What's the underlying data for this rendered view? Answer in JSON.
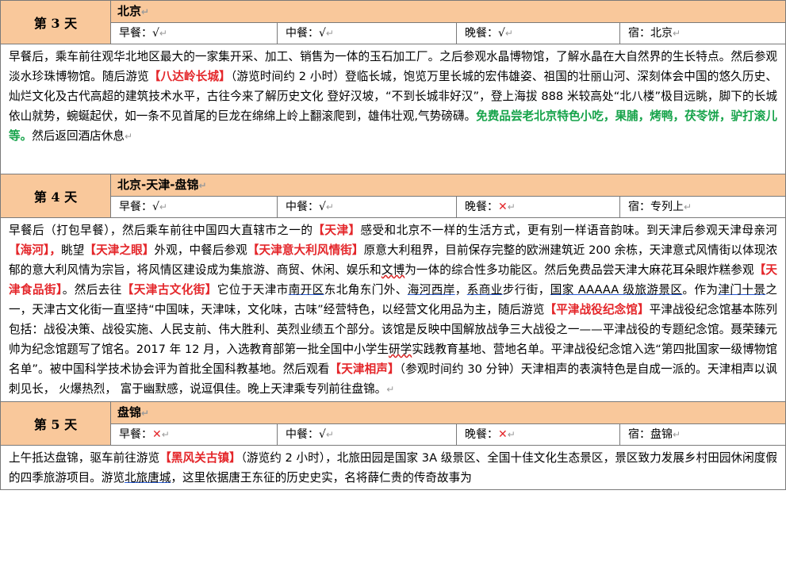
{
  "paragraph_mark": "↵",
  "days": [
    {
      "label": "第 3 天",
      "route": "北京",
      "breakfast": {
        "label": "早餐：",
        "mark": "√"
      },
      "lunch": {
        "label": "中餐：",
        "mark": "√"
      },
      "dinner": {
        "label": "晚餐：",
        "mark": "√"
      },
      "lodging": {
        "label": "宿：",
        "value": "北京"
      },
      "segments": [
        {
          "text": "早餐后，乘车前往观华北地区最大的一家集开采、加工、销售为一体的玉石加工厂。之后参观水晶博物馆，了解水晶在大自然界的生长特点。然后参观淡水珍珠博物馆。随后游览"
        },
        {
          "text": "【八达岭长城】",
          "style": "red"
        },
        {
          "text": "（游览时间约 2 小时）登临长城，饱览万里长城的宏伟雄姿、祖国的壮丽山河、深刻体会中国的悠久历史、灿烂文化及古代高超的建筑技术水平，古往今来了解历史文化 登好汉坡，“不到长城非好汉”，登上海拔 888 米较高处“北八楼”极目远眺，脚下的长城依山就势，蜿蜒起伏，如一条不见首尾的巨龙在绵绵上岭上翻滚爬到，雄伟壮观,气势磅礴。"
        },
        {
          "text": "免费品尝老北京特色小吃，果脯，烤鸭，茯苓饼，驴打滚儿等。",
          "style": "green"
        },
        {
          "text": "然后返回酒店休息"
        }
      ]
    },
    {
      "label": "第 4 天",
      "route": "北京-天津-盘锦",
      "breakfast": {
        "label": "早餐：",
        "mark": "√"
      },
      "lunch": {
        "label": "中餐：",
        "mark": "√"
      },
      "dinner": {
        "label": "晚餐：",
        "mark": "✕"
      },
      "lodging": {
        "label": "宿：",
        "value": "专列上"
      },
      "segments": [
        {
          "text": "早餐后（打包早餐），然后乘车前往中国四大直辖市之一的"
        },
        {
          "text": "【天津】",
          "style": "red"
        },
        {
          "text": "感受和北京不一样的生活方式，更有别一样语音韵味。到天津后参观天津母亲河"
        },
        {
          "text": "【海河】，",
          "style": "red"
        },
        {
          "text": "眺望"
        },
        {
          "text": "【天津之眼】",
          "style": "red"
        },
        {
          "text": "外观，中餐后参观"
        },
        {
          "text": "【天津意大利风情街】",
          "style": "red"
        },
        {
          "text": "原意大利租界，目前保存完整的欧洲建筑近 200 余栋，天津意式风情街以体现浓郁的意大利风情为宗旨，将风情区建设成为集旅游、商贸、休闲、娱乐和"
        },
        {
          "text": "文博",
          "style": "wavy"
        },
        {
          "text": "为一体的综合性多功能区。然后免费品尝天津大麻花耳朵眼炸糕参观"
        },
        {
          "text": "【天津食品街】",
          "style": "red"
        },
        {
          "text": "。然后去往"
        },
        {
          "text": "【天津古文化街】",
          "style": "red"
        },
        {
          "text": "它位于天津市"
        },
        {
          "text": "南开区",
          "style": "ul"
        },
        {
          "text": "东北角东门外、"
        },
        {
          "text": "海河西岸",
          "style": "ul"
        },
        {
          "text": "，"
        },
        {
          "text": "系商业",
          "style": "ul"
        },
        {
          "text": "步行街，"
        },
        {
          "text": "国家 AAAAA 级旅游景区",
          "style": "ul"
        },
        {
          "text": "。作为"
        },
        {
          "text": "津门十景",
          "style": "ul"
        },
        {
          "text": "之一，天津古文化街一直坚持“中国味，天津味，文化味，古味”经营特色，以经营文化用品为主，随后游览"
        },
        {
          "text": "【平津战役纪念馆】",
          "style": "red"
        },
        {
          "text": "平津战役纪念馆基本陈列包括：战役决策、战役实施、人民支前、伟大胜利、英烈业绩五个部分。该馆是反映中国解放战争三大战役之一——平津战役的专题纪念馆。聂荣臻元帅为纪念馆题写了馆名。2017 年 12 月，入选教育部第一批全国中小学生"
        },
        {
          "text": "研学",
          "style": "wavy"
        },
        {
          "text": "实践教育基地、营地名单。平津战役纪念馆入选“第四批国家一级博物馆名单”。被中国科学技术协会评为首批全国科教基地。然后观看"
        },
        {
          "text": "【天津相声】",
          "style": "red"
        },
        {
          "text": "（参观时间约 30 分钟）天津相声的表演特色是自成一派的。天津相声以讽刺见长， 火爆热烈， 富于幽默感，说逗俱佳。晚上天津乘专列前往盘锦。"
        }
      ]
    },
    {
      "label": "第 5 天",
      "route": "盘锦",
      "breakfast": {
        "label": "早餐：",
        "mark": "✕"
      },
      "lunch": {
        "label": "中餐：",
        "mark": "√"
      },
      "dinner": {
        "label": "晚餐：",
        "mark": "✕"
      },
      "lodging": {
        "label": "宿：",
        "value": "盘锦"
      },
      "segments": [
        {
          "text": "上午抵达盘锦，驱车前往游览"
        },
        {
          "text": "【黑风关古镇】",
          "style": "red"
        },
        {
          "text": "（游览约 2 小时），北旅田园是国家 3A 级景区、全国十佳文化生态景区，景区致力发展乡村田园休闲度假的四季旅游项目。游览"
        },
        {
          "text": "北旅唐城",
          "style": "ul"
        },
        {
          "text": "，这里依据唐王东征的历史史实，名将薛仁贵的传奇故事为"
        }
      ]
    }
  ]
}
